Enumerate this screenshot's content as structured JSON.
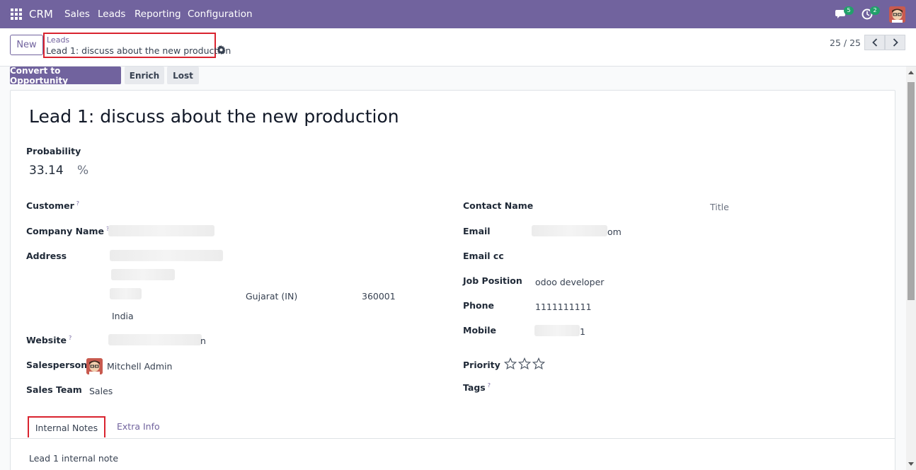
{
  "navbar": {
    "app_name": "CRM",
    "menu": [
      "Sales",
      "Leads",
      "Reporting",
      "Configuration"
    ],
    "messages_count": "5",
    "activities_count": "2",
    "accent_color": "#71639e"
  },
  "control_panel": {
    "new_label": "New",
    "breadcrumb_parent": "Leads",
    "breadcrumb_current": "Lead 1: discuss about the new production",
    "pager": "25 / 25"
  },
  "actions": {
    "convert": "Convert to Opportunity",
    "enrich": "Enrich",
    "lost": "Lost"
  },
  "form": {
    "title": "Lead 1: discuss about the new production",
    "probability_label": "Probability",
    "probability_value": "33.14",
    "probability_unit": "%",
    "left": {
      "customer_label": "Customer",
      "company_name_label": "Company Name",
      "address_label": "Address",
      "state": "Gujarat (IN)",
      "zip": "360001",
      "country": "India",
      "website_label": "Website",
      "website_suffix": "n",
      "salesperson_label": "Salesperson",
      "salesperson": "Mitchell Admin",
      "sales_team_label": "Sales Team",
      "sales_team": "Sales"
    },
    "right": {
      "contact_name_label": "Contact Name",
      "title_placeholder": "Title",
      "email_label": "Email",
      "email_suffix": "om",
      "email_cc_label": "Email cc",
      "job_position_label": "Job Position",
      "job_position": "odoo developer",
      "phone_label": "Phone",
      "phone": "1111111111",
      "mobile_label": "Mobile",
      "mobile_suffix": "1",
      "priority_label": "Priority",
      "priority_stars": 0,
      "tags_label": "Tags"
    },
    "help_mark": "?",
    "tabs": [
      "Internal Notes",
      "Extra Info"
    ],
    "internal_note": "Lead 1 internal note"
  }
}
